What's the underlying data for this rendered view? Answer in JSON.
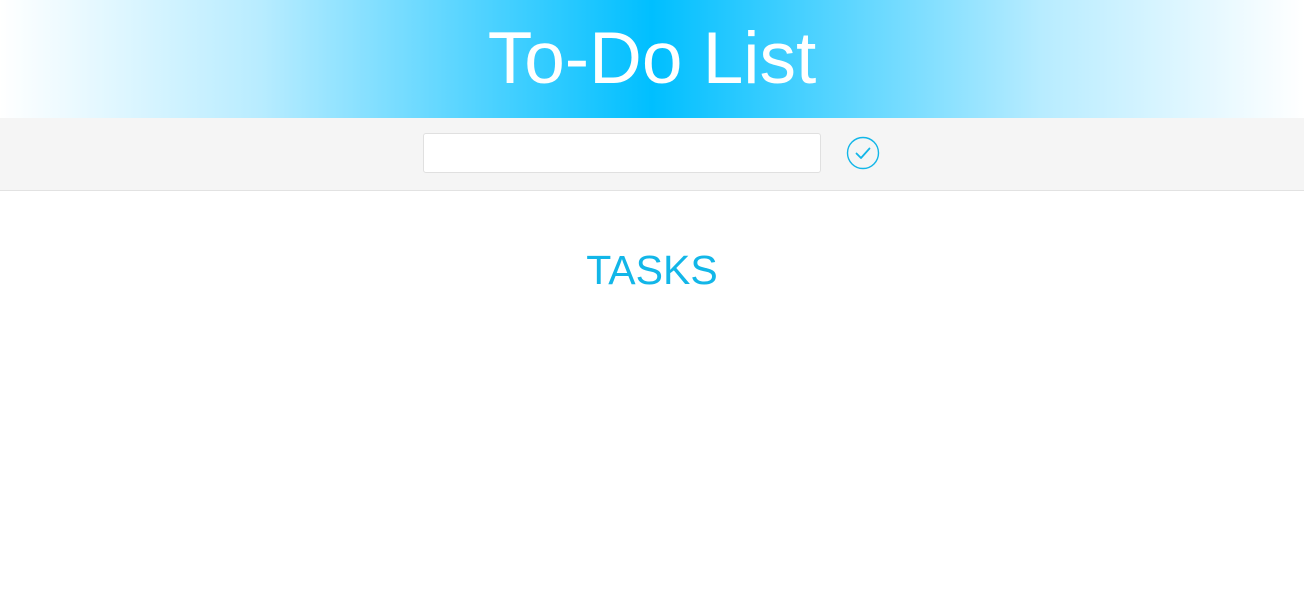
{
  "header": {
    "title": "To-Do List"
  },
  "task_input": {
    "value": "",
    "placeholder": ""
  },
  "add_button": {
    "icon": "check-circle-icon"
  },
  "tasks": {
    "heading": "TASKS",
    "items": []
  },
  "colors": {
    "accent": "#00bfff",
    "heading": "#12b6e8",
    "bar_background": "#f5f5f5"
  }
}
